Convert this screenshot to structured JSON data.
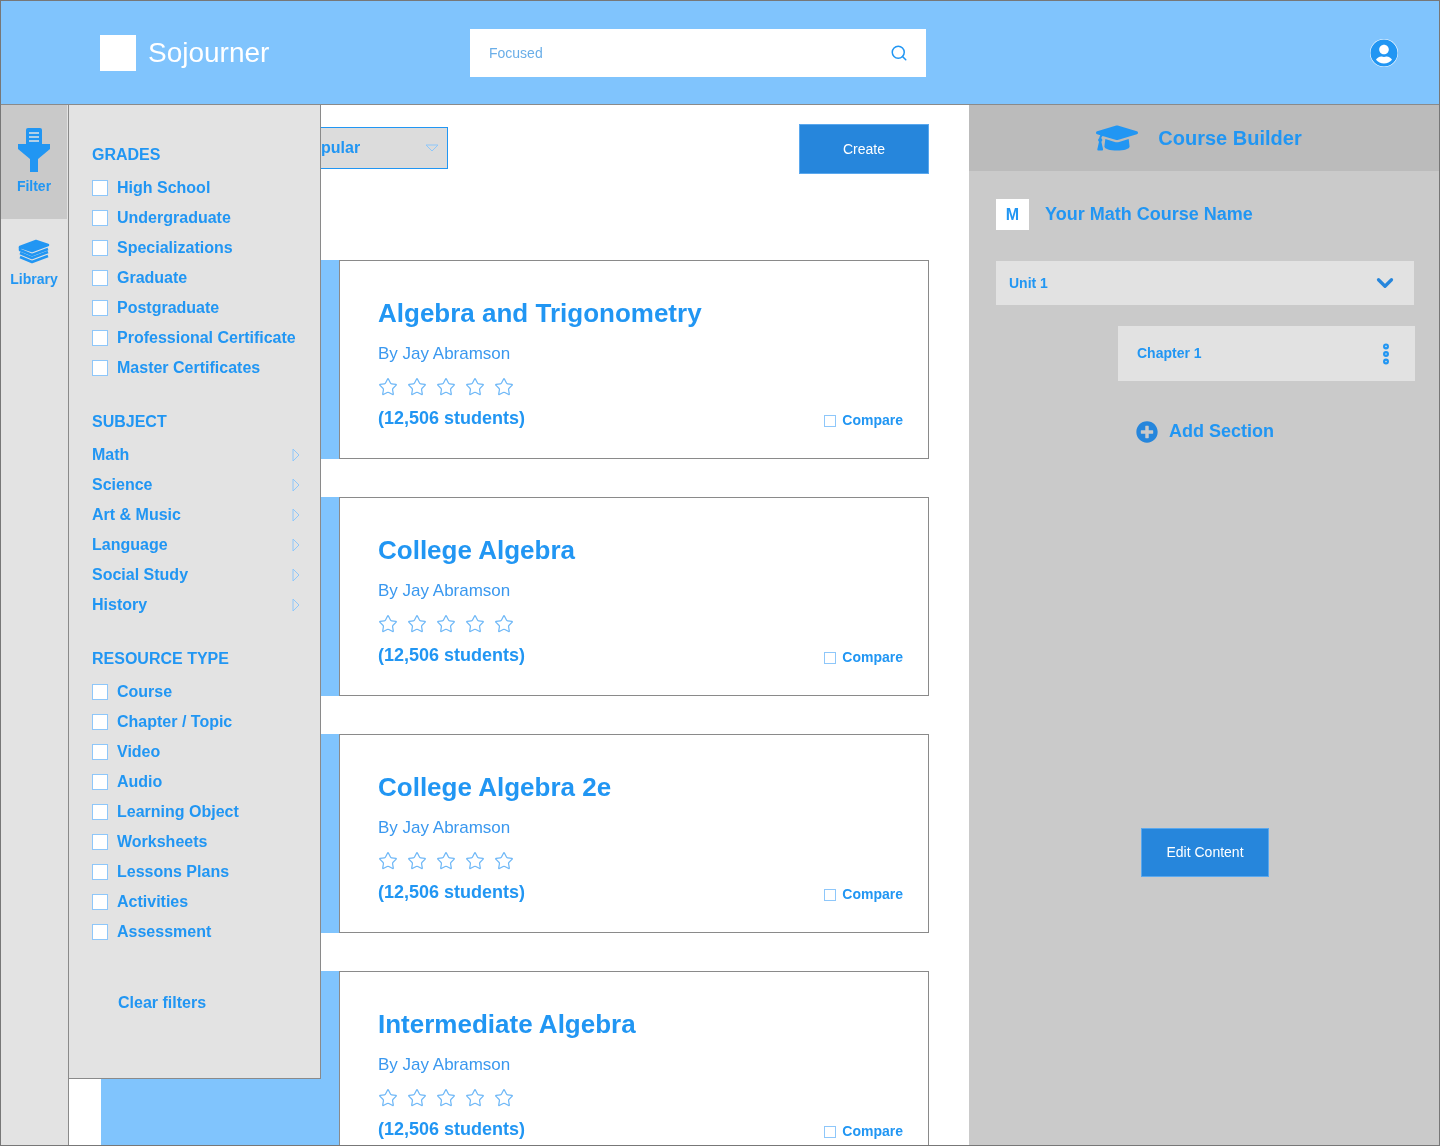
{
  "header": {
    "logo": "Sojourner",
    "search": {
      "placeholder": "Focused"
    }
  },
  "rail": [
    {
      "kind": "filter",
      "label": "Filter",
      "selected": true
    },
    {
      "kind": "library",
      "label": "Library",
      "selected": false
    }
  ],
  "filters": {
    "sections": [
      {
        "title": "GRADES",
        "kind": "checkbox",
        "items": [
          {
            "label": "High School",
            "checked": false
          },
          {
            "label": "Undergraduate",
            "checked": false
          },
          {
            "label": "Specializations",
            "checked": false
          },
          {
            "label": "Graduate",
            "checked": false
          },
          {
            "label": "Postgraduate",
            "checked": false
          },
          {
            "label": "Professional Certificate",
            "checked": false
          },
          {
            "label": "Master Certificates",
            "checked": false
          }
        ]
      },
      {
        "title": "SUBJECT",
        "kind": "submenu",
        "items": [
          {
            "label": "Math"
          },
          {
            "label": "Science"
          },
          {
            "label": "Art & Music"
          },
          {
            "label": "Language"
          },
          {
            "label": "Social Study"
          },
          {
            "label": "History"
          }
        ]
      },
      {
        "title": "RESOURCE TYPE",
        "kind": "checkbox",
        "items": [
          {
            "label": "Course",
            "checked": false
          },
          {
            "label": "Chapter / Topic",
            "checked": false
          },
          {
            "label": "Video",
            "checked": false
          },
          {
            "label": "Audio",
            "checked": false
          },
          {
            "label": "Learning Object",
            "checked": false
          },
          {
            "label": "Worksheets",
            "checked": false
          },
          {
            "label": "Lessons Plans",
            "checked": false
          },
          {
            "label": "Activities",
            "checked": false
          },
          {
            "label": "Assessment",
            "checked": false
          }
        ]
      }
    ],
    "clear": "Clear filters"
  },
  "sort": {
    "value": "pular"
  },
  "create_button": "Create",
  "courses": [
    {
      "title": "Algebra and Trigonometry",
      "author": "By Jay Abramson",
      "stars": 0,
      "students": "(12,506 students)",
      "compare": {
        "label": "Compare",
        "checked": false
      }
    },
    {
      "title": "College Algebra",
      "author": "By Jay Abramson",
      "stars": 0,
      "students": "(12,506 students)",
      "compare": {
        "label": "Compare",
        "checked": false
      }
    },
    {
      "title": "College Algebra 2e",
      "author": "By Jay Abramson",
      "stars": 0,
      "students": "(12,506 students)",
      "compare": {
        "label": "Compare",
        "checked": false
      }
    },
    {
      "title": "Intermediate Algebra",
      "author": "By Jay Abramson",
      "stars": 0,
      "students": "(12,506 students)",
      "compare": {
        "label": "Compare",
        "checked": false
      }
    }
  ],
  "builder": {
    "title": "Course Builder",
    "course": {
      "initial": "M",
      "name": "Your Math Course Name"
    },
    "unit": {
      "label": "Unit 1",
      "expanded": true
    },
    "chapter": {
      "label": "Chapter 1"
    },
    "add_section": "Add Section",
    "edit_button": "Edit Content"
  }
}
